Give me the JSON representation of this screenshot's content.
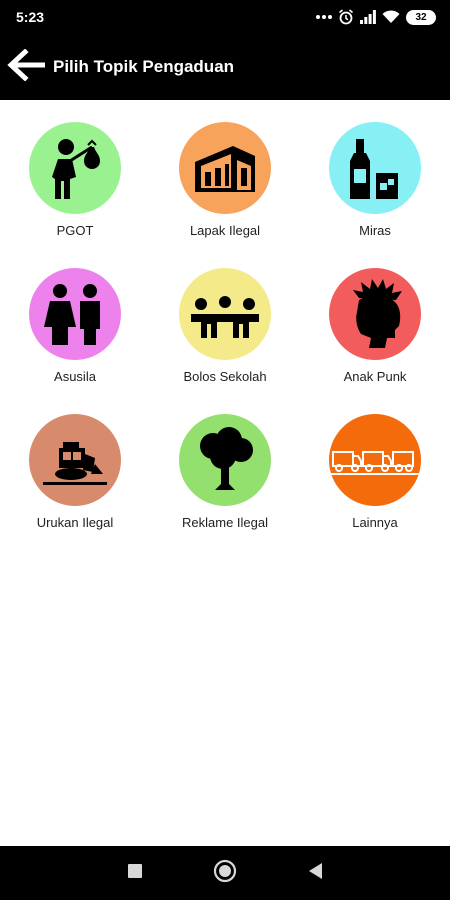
{
  "status_bar": {
    "time": "5:23",
    "battery": "32",
    "icons": [
      "dots-icon",
      "alarm-icon",
      "signal-icon",
      "wifi-icon",
      "battery-icon"
    ]
  },
  "app_bar": {
    "title": "Pilih Topik Pengaduan",
    "back_icon": "arrow-left-icon"
  },
  "topics": [
    {
      "label": "PGOT",
      "color": "#99f28f",
      "icon": "vagrant-icon"
    },
    {
      "label": "Lapak Ilegal",
      "color": "#f8a35c",
      "icon": "stall-icon"
    },
    {
      "label": "Miras",
      "color": "#86f0f5",
      "icon": "liquor-icon"
    },
    {
      "label": "Asusila",
      "color": "#ee82ec",
      "icon": "couple-icon"
    },
    {
      "label": "Bolos Sekolah",
      "color": "#f4ea8a",
      "icon": "children-icon"
    },
    {
      "label": "Anak Punk",
      "color": "#f35c5c",
      "icon": "punk-icon"
    },
    {
      "label": "Urukan Ilegal",
      "color": "#d88b6c",
      "icon": "bulldozer-icon"
    },
    {
      "label": "Reklame Ilegal",
      "color": "#93e06f",
      "icon": "tree-icon"
    },
    {
      "label": "Lainnya",
      "color": "#f46b0c",
      "icon": "trucks-icon"
    }
  ],
  "nav_bar": {
    "icons": [
      "recents-square-icon",
      "home-circle-icon",
      "back-triangle-icon"
    ]
  }
}
